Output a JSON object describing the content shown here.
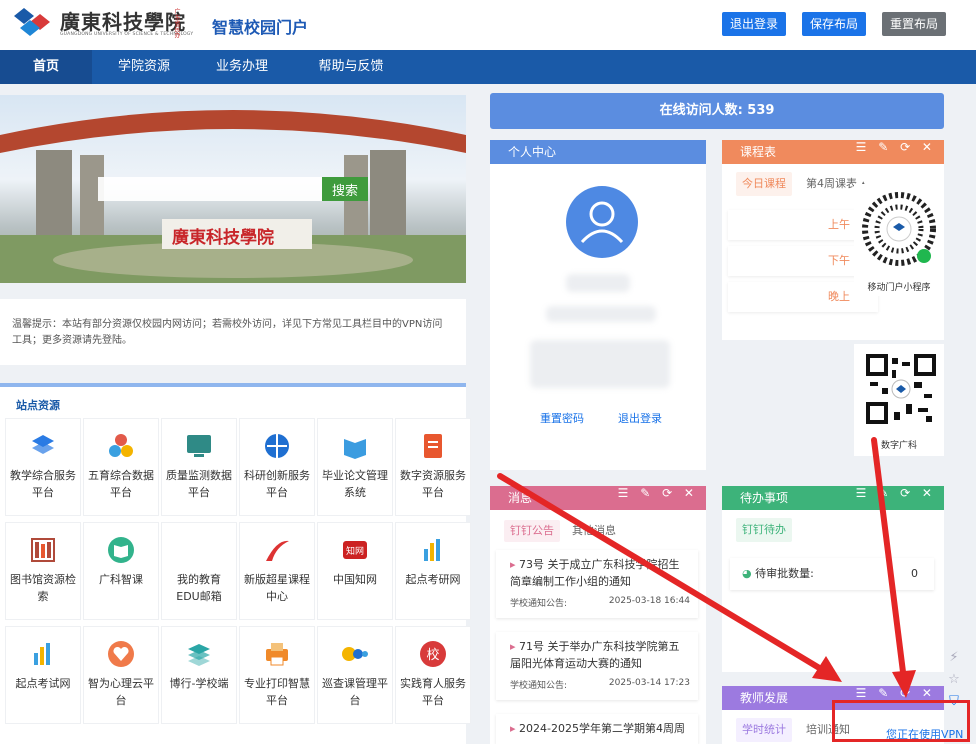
{
  "header": {
    "logo_text": "廣東科技學院",
    "logo_en": "GUANGDONG UNIVERSITY OF SCIENCE & TECHNOLOGY",
    "logo_tag": "广东省民办",
    "portal_title": "智慧校园门户",
    "buttons": {
      "logout": "退出登录",
      "save_layout": "保存布局",
      "reset_layout": "重置布局"
    },
    "colors": {
      "primary": "#1a73e8",
      "nav": "#1a5aa8",
      "reset": "#6b7075"
    }
  },
  "nav": {
    "items": [
      "首页",
      "学院资源",
      "业务办理",
      "帮助与反馈"
    ],
    "active": "首页"
  },
  "banner": {
    "gate_text": "廣東科技學院",
    "search_placeholder": "",
    "search_button": "搜索"
  },
  "notice": "温馨提示：本站有部分资源仅校园内网访问；若需校外访问，详见下方常见工具栏目中的VPN访问工具；更多资源请先登陆。",
  "sites": {
    "title": "站点资源",
    "items": [
      {
        "label": "教学综合服务平台",
        "icon": "layers-icon"
      },
      {
        "label": "五育综合数据平台",
        "icon": "circles-icon"
      },
      {
        "label": "质量监测数据平台",
        "icon": "monitor-icon"
      },
      {
        "label": "科研创新服务平台",
        "icon": "globe-icon"
      },
      {
        "label": "毕业论文管理系统",
        "icon": "book-icon"
      },
      {
        "label": "数字资源服务平台",
        "icon": "document-icon"
      },
      {
        "label": "图书馆资源检索",
        "icon": "bookshelf-icon"
      },
      {
        "label": "广科智课",
        "icon": "open-book-icon"
      },
      {
        "label": "我的教育EDU邮箱",
        "icon": "infinity-icon"
      },
      {
        "label": "新版超星课程中心",
        "icon": "star-icon"
      },
      {
        "label": "中国知网",
        "icon": "cnki-icon"
      },
      {
        "label": "起点考研网",
        "icon": "bars-icon"
      },
      {
        "label": "起点考试网",
        "icon": "bars-icon"
      },
      {
        "label": "智为心理云平台",
        "icon": "heart-icon"
      },
      {
        "label": "博行-学校端",
        "icon": "stack-icon"
      },
      {
        "label": "专业打印智慧平台",
        "icon": "printer-icon"
      },
      {
        "label": "巡查课管理平台",
        "icon": "dots-icon"
      },
      {
        "label": "实践育人服务平台",
        "icon": "school-icon"
      }
    ]
  },
  "online": {
    "label": "在线访问人数:",
    "count": "539"
  },
  "personal": {
    "title": "个人中心",
    "reset_pwd": "重置密码",
    "logout": "退出登录"
  },
  "course": {
    "title": "课程表",
    "tab_today": "今日课程",
    "week": "第4周课表",
    "slots": [
      "上午",
      "下午",
      "晚上"
    ]
  },
  "qr": [
    {
      "caption": "移动门户小程序"
    },
    {
      "caption": "数字广科"
    }
  ],
  "messages": {
    "title": "消息",
    "tabs": [
      "钉钉公告",
      "其他消息"
    ],
    "items": [
      {
        "number": "73号",
        "title": "关于成立广东科技学院招生简章编制工作小组的通知",
        "source": "学校通知公告:",
        "date": "2025-03-18 16:44"
      },
      {
        "number": "71号",
        "title": "关于举办广东科技学院第五届阳光体育运动大赛的通知",
        "source": "学校通知公告:",
        "date": "2025-03-14 17:23"
      },
      {
        "number": "",
        "title": "2024-2025学年第二学期第4周周",
        "source": "",
        "date": ""
      }
    ]
  },
  "todo": {
    "title": "待办事项",
    "tab": "钉钉待办",
    "row_label": "待审批数量:",
    "row_value": "0"
  },
  "teacher": {
    "title": "教师发展",
    "tabs": [
      "学时统计",
      "培训通知"
    ]
  },
  "vpn": {
    "text": "您正在使用VPN"
  },
  "colors": {
    "course": "#f08a5d",
    "messages": "#db6d8f",
    "todo": "#3db37a",
    "teacher": "#9c7ae0",
    "annotation": "#e42626"
  }
}
